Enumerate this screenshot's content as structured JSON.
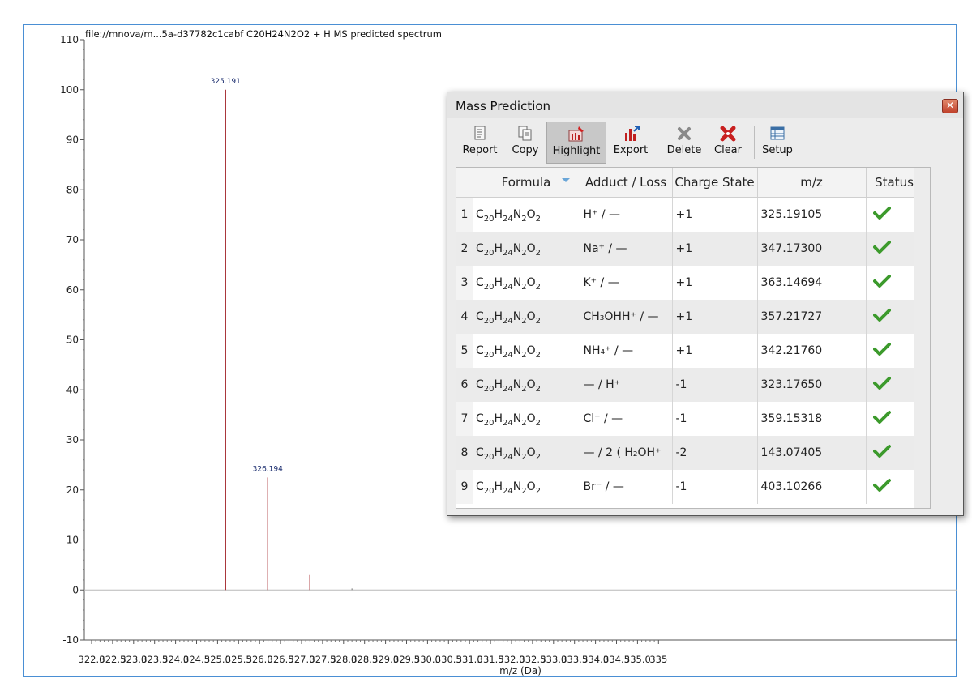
{
  "chart_data": {
    "type": "bar",
    "title": "file://mnova/m...5a-d37782c1cabf   C20H24N2O2 + H MS predicted spectrum",
    "xlabel": "m/z (Da)",
    "ylabel": "",
    "xlim": [
      322.0,
      335.0
    ],
    "ylim": [
      -10,
      110
    ],
    "yticks": [
      "110",
      "100",
      "90",
      "80",
      "70",
      "60",
      "50",
      "40",
      "30",
      "20",
      "10",
      "0",
      "-10"
    ],
    "xticks": [
      "322.0",
      "322.5",
      "323.0",
      "323.5",
      "324.0",
      "324.5",
      "325.0",
      "325.5",
      "326.0",
      "326.5",
      "327.0",
      "327.5",
      "328.0",
      "328.5",
      "329.0",
      "329.5",
      "330.0",
      "330.5",
      "331.0",
      "331.5",
      "332.0",
      "332.5",
      "333.0",
      "333.5",
      "334.0",
      "334.5",
      "335.0",
      "335"
    ],
    "peaks": [
      {
        "x": 325.191,
        "y": 100,
        "label": "325.191"
      },
      {
        "x": 326.194,
        "y": 22.5,
        "label": "326.194"
      },
      {
        "x": 327.197,
        "y": 3,
        "label": ""
      },
      {
        "x": 328.2,
        "y": 0.3,
        "label": ""
      }
    ],
    "colors": {
      "peak": "#a01f24",
      "frame": "#4a8fd4",
      "label": "#1a2c6e"
    }
  },
  "dialog": {
    "title": "Mass Prediction",
    "close_glyph": "✕",
    "toolbar": [
      {
        "label": "Report",
        "icon": "report-icon"
      },
      {
        "label": "Copy",
        "icon": "copy-icon"
      },
      {
        "label": "Highlight",
        "icon": "highlight-icon"
      },
      {
        "label": "Export",
        "icon": "export-icon"
      },
      {
        "label": "Delete",
        "icon": "delete-icon"
      },
      {
        "label": "Clear",
        "icon": "clear-icon"
      },
      {
        "label": "Setup",
        "icon": "setup-icon"
      }
    ],
    "columns": [
      "Formula",
      "Adduct / Loss",
      "Charge State",
      "m/z",
      "Status"
    ],
    "rows": [
      {
        "num": "1",
        "adduct": "H⁺ / —",
        "charge": "+1",
        "mz": "325.19105",
        "status": "ok"
      },
      {
        "num": "2",
        "adduct": "Na⁺ / —",
        "charge": "+1",
        "mz": "347.17300",
        "status": "ok"
      },
      {
        "num": "3",
        "adduct": "K⁺ / —",
        "charge": "+1",
        "mz": "363.14694",
        "status": "ok"
      },
      {
        "num": "4",
        "adduct": "CH₃OHH⁺ / —",
        "charge": "+1",
        "mz": "357.21727",
        "status": "ok"
      },
      {
        "num": "5",
        "adduct": "NH₄⁺ / —",
        "charge": "+1",
        "mz": "342.21760",
        "status": "ok"
      },
      {
        "num": "6",
        "adduct": "— / H⁺",
        "charge": "-1",
        "mz": "323.17650",
        "status": "ok"
      },
      {
        "num": "7",
        "adduct": "Cl⁻ / —",
        "charge": "-1",
        "mz": "359.15318",
        "status": "ok"
      },
      {
        "num": "8",
        "adduct": "— / 2 ( H₂OH⁺",
        "charge": "-2",
        "mz": "143.07405",
        "status": "ok"
      },
      {
        "num": "9",
        "adduct": "Br⁻ / —",
        "charge": "-1",
        "mz": "403.10266",
        "status": "ok"
      }
    ],
    "formula": {
      "C": "C",
      "c_n": "20",
      "H": "H",
      "h_n": "24",
      "N": "N",
      "n_n": "2",
      "O": "O",
      "o_n": "2"
    }
  }
}
